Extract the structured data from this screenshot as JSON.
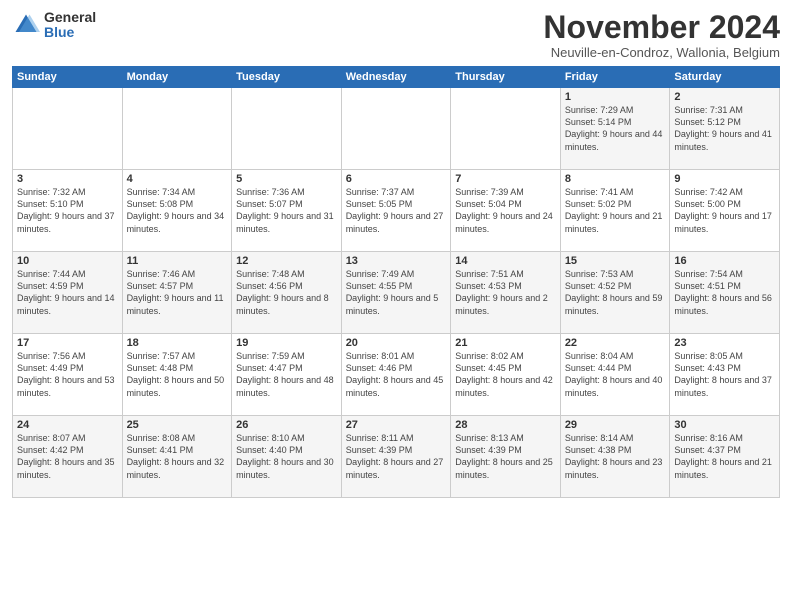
{
  "logo": {
    "general": "General",
    "blue": "Blue"
  },
  "header": {
    "month": "November 2024",
    "location": "Neuville-en-Condroz, Wallonia, Belgium"
  },
  "weekdays": [
    "Sunday",
    "Monday",
    "Tuesday",
    "Wednesday",
    "Thursday",
    "Friday",
    "Saturday"
  ],
  "weeks": [
    [
      {
        "day": "",
        "info": ""
      },
      {
        "day": "",
        "info": ""
      },
      {
        "day": "",
        "info": ""
      },
      {
        "day": "",
        "info": ""
      },
      {
        "day": "",
        "info": ""
      },
      {
        "day": "1",
        "info": "Sunrise: 7:29 AM\nSunset: 5:14 PM\nDaylight: 9 hours\nand 44 minutes."
      },
      {
        "day": "2",
        "info": "Sunrise: 7:31 AM\nSunset: 5:12 PM\nDaylight: 9 hours\nand 41 minutes."
      }
    ],
    [
      {
        "day": "3",
        "info": "Sunrise: 7:32 AM\nSunset: 5:10 PM\nDaylight: 9 hours\nand 37 minutes."
      },
      {
        "day": "4",
        "info": "Sunrise: 7:34 AM\nSunset: 5:08 PM\nDaylight: 9 hours\nand 34 minutes."
      },
      {
        "day": "5",
        "info": "Sunrise: 7:36 AM\nSunset: 5:07 PM\nDaylight: 9 hours\nand 31 minutes."
      },
      {
        "day": "6",
        "info": "Sunrise: 7:37 AM\nSunset: 5:05 PM\nDaylight: 9 hours\nand 27 minutes."
      },
      {
        "day": "7",
        "info": "Sunrise: 7:39 AM\nSunset: 5:04 PM\nDaylight: 9 hours\nand 24 minutes."
      },
      {
        "day": "8",
        "info": "Sunrise: 7:41 AM\nSunset: 5:02 PM\nDaylight: 9 hours\nand 21 minutes."
      },
      {
        "day": "9",
        "info": "Sunrise: 7:42 AM\nSunset: 5:00 PM\nDaylight: 9 hours\nand 17 minutes."
      }
    ],
    [
      {
        "day": "10",
        "info": "Sunrise: 7:44 AM\nSunset: 4:59 PM\nDaylight: 9 hours\nand 14 minutes."
      },
      {
        "day": "11",
        "info": "Sunrise: 7:46 AM\nSunset: 4:57 PM\nDaylight: 9 hours\nand 11 minutes."
      },
      {
        "day": "12",
        "info": "Sunrise: 7:48 AM\nSunset: 4:56 PM\nDaylight: 9 hours\nand 8 minutes."
      },
      {
        "day": "13",
        "info": "Sunrise: 7:49 AM\nSunset: 4:55 PM\nDaylight: 9 hours\nand 5 minutes."
      },
      {
        "day": "14",
        "info": "Sunrise: 7:51 AM\nSunset: 4:53 PM\nDaylight: 9 hours\nand 2 minutes."
      },
      {
        "day": "15",
        "info": "Sunrise: 7:53 AM\nSunset: 4:52 PM\nDaylight: 8 hours\nand 59 minutes."
      },
      {
        "day": "16",
        "info": "Sunrise: 7:54 AM\nSunset: 4:51 PM\nDaylight: 8 hours\nand 56 minutes."
      }
    ],
    [
      {
        "day": "17",
        "info": "Sunrise: 7:56 AM\nSunset: 4:49 PM\nDaylight: 8 hours\nand 53 minutes."
      },
      {
        "day": "18",
        "info": "Sunrise: 7:57 AM\nSunset: 4:48 PM\nDaylight: 8 hours\nand 50 minutes."
      },
      {
        "day": "19",
        "info": "Sunrise: 7:59 AM\nSunset: 4:47 PM\nDaylight: 8 hours\nand 48 minutes."
      },
      {
        "day": "20",
        "info": "Sunrise: 8:01 AM\nSunset: 4:46 PM\nDaylight: 8 hours\nand 45 minutes."
      },
      {
        "day": "21",
        "info": "Sunrise: 8:02 AM\nSunset: 4:45 PM\nDaylight: 8 hours\nand 42 minutes."
      },
      {
        "day": "22",
        "info": "Sunrise: 8:04 AM\nSunset: 4:44 PM\nDaylight: 8 hours\nand 40 minutes."
      },
      {
        "day": "23",
        "info": "Sunrise: 8:05 AM\nSunset: 4:43 PM\nDaylight: 8 hours\nand 37 minutes."
      }
    ],
    [
      {
        "day": "24",
        "info": "Sunrise: 8:07 AM\nSunset: 4:42 PM\nDaylight: 8 hours\nand 35 minutes."
      },
      {
        "day": "25",
        "info": "Sunrise: 8:08 AM\nSunset: 4:41 PM\nDaylight: 8 hours\nand 32 minutes."
      },
      {
        "day": "26",
        "info": "Sunrise: 8:10 AM\nSunset: 4:40 PM\nDaylight: 8 hours\nand 30 minutes."
      },
      {
        "day": "27",
        "info": "Sunrise: 8:11 AM\nSunset: 4:39 PM\nDaylight: 8 hours\nand 27 minutes."
      },
      {
        "day": "28",
        "info": "Sunrise: 8:13 AM\nSunset: 4:39 PM\nDaylight: 8 hours\nand 25 minutes."
      },
      {
        "day": "29",
        "info": "Sunrise: 8:14 AM\nSunset: 4:38 PM\nDaylight: 8 hours\nand 23 minutes."
      },
      {
        "day": "30",
        "info": "Sunrise: 8:16 AM\nSunset: 4:37 PM\nDaylight: 8 hours\nand 21 minutes."
      }
    ]
  ]
}
